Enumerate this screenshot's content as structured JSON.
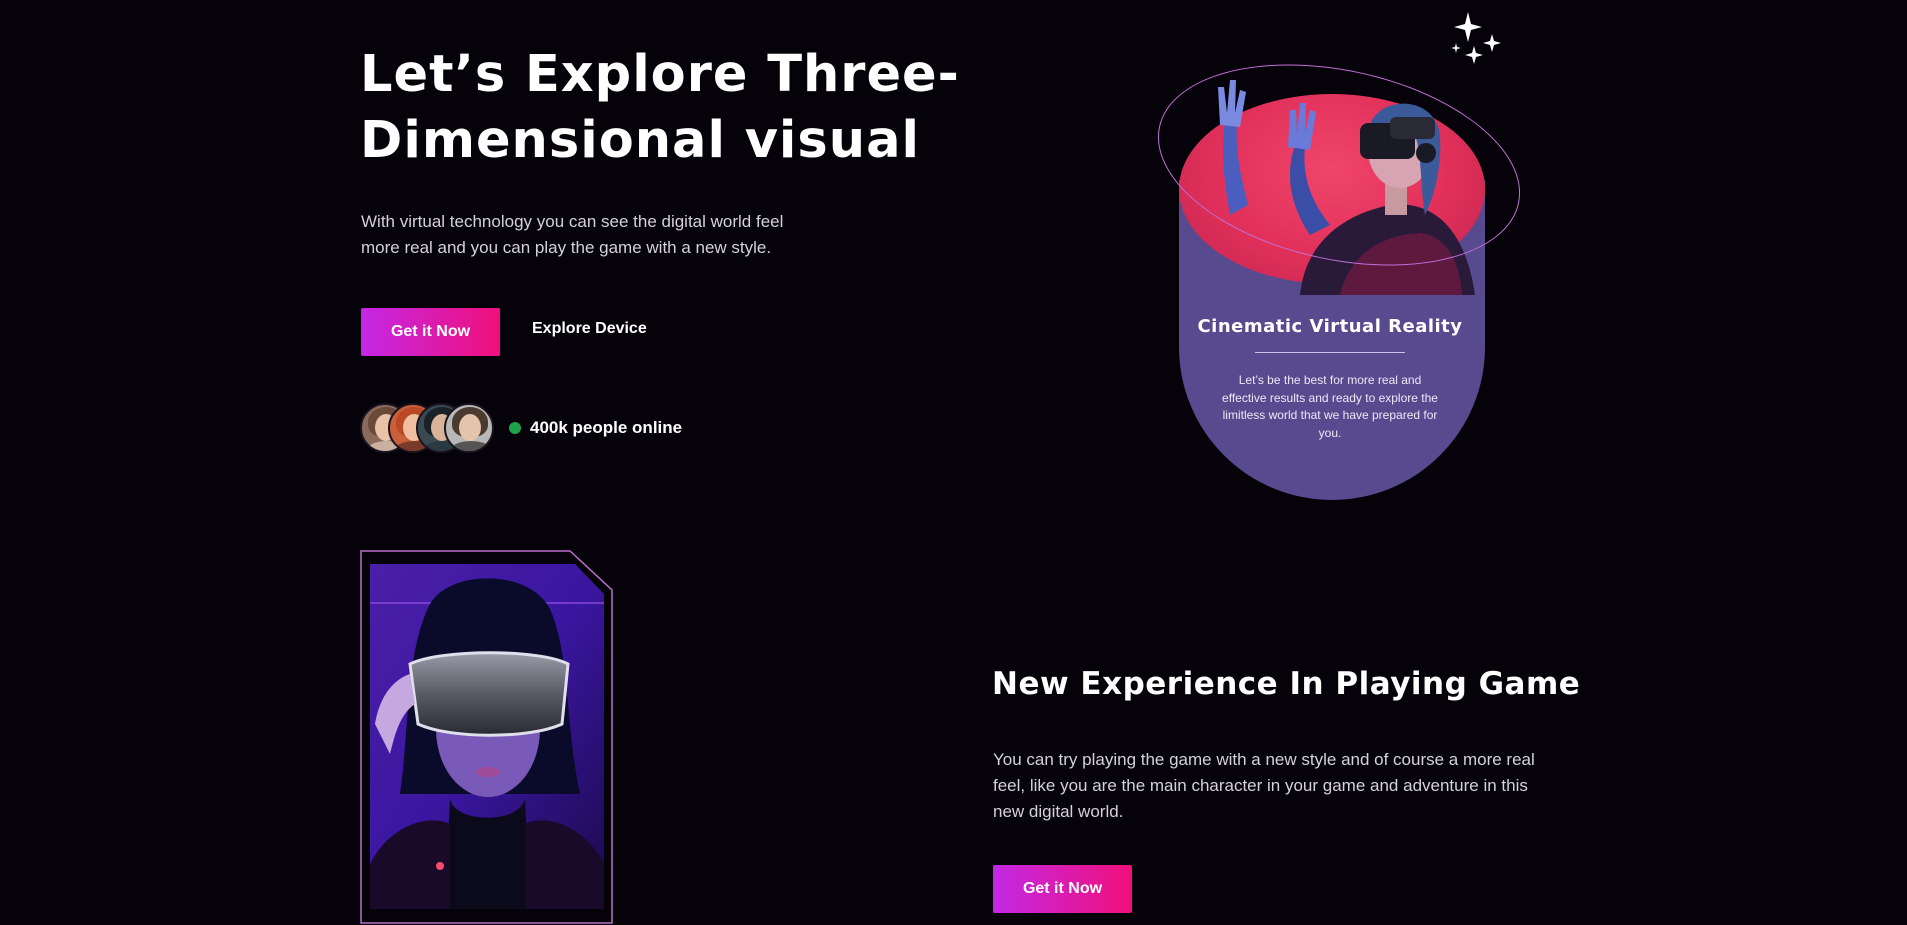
{
  "hero": {
    "title": "Let’s Explore Three-Dimensional visual",
    "description": "With virtual technology you can see the digital world feel more real and you can play the game with a new style.",
    "primary_button": "Get it Now",
    "secondary_link": "Explore Device",
    "online_text": "400k people online"
  },
  "vr_card": {
    "title": "Cinematic Virtual Reality",
    "text": "Let’s be the best for more real and effective results and ready to explore the limitless world that we have prepared for you."
  },
  "experience": {
    "title": "New Experience In Playing Game",
    "description": "You can try playing the game with a new style and of course a more real feel, like you are the main character in your game and adventure in this new digital world.",
    "button": "Get it Now"
  },
  "colors": {
    "background": "#050309",
    "button_gradient_start": "#c428e6",
    "button_gradient_end": "#f0107a",
    "card_purple": "#574a8f",
    "card_red": "#e0305a",
    "online_green": "#1fa34a"
  },
  "icons": [
    "sparkle-icon",
    "online-status-icon"
  ]
}
